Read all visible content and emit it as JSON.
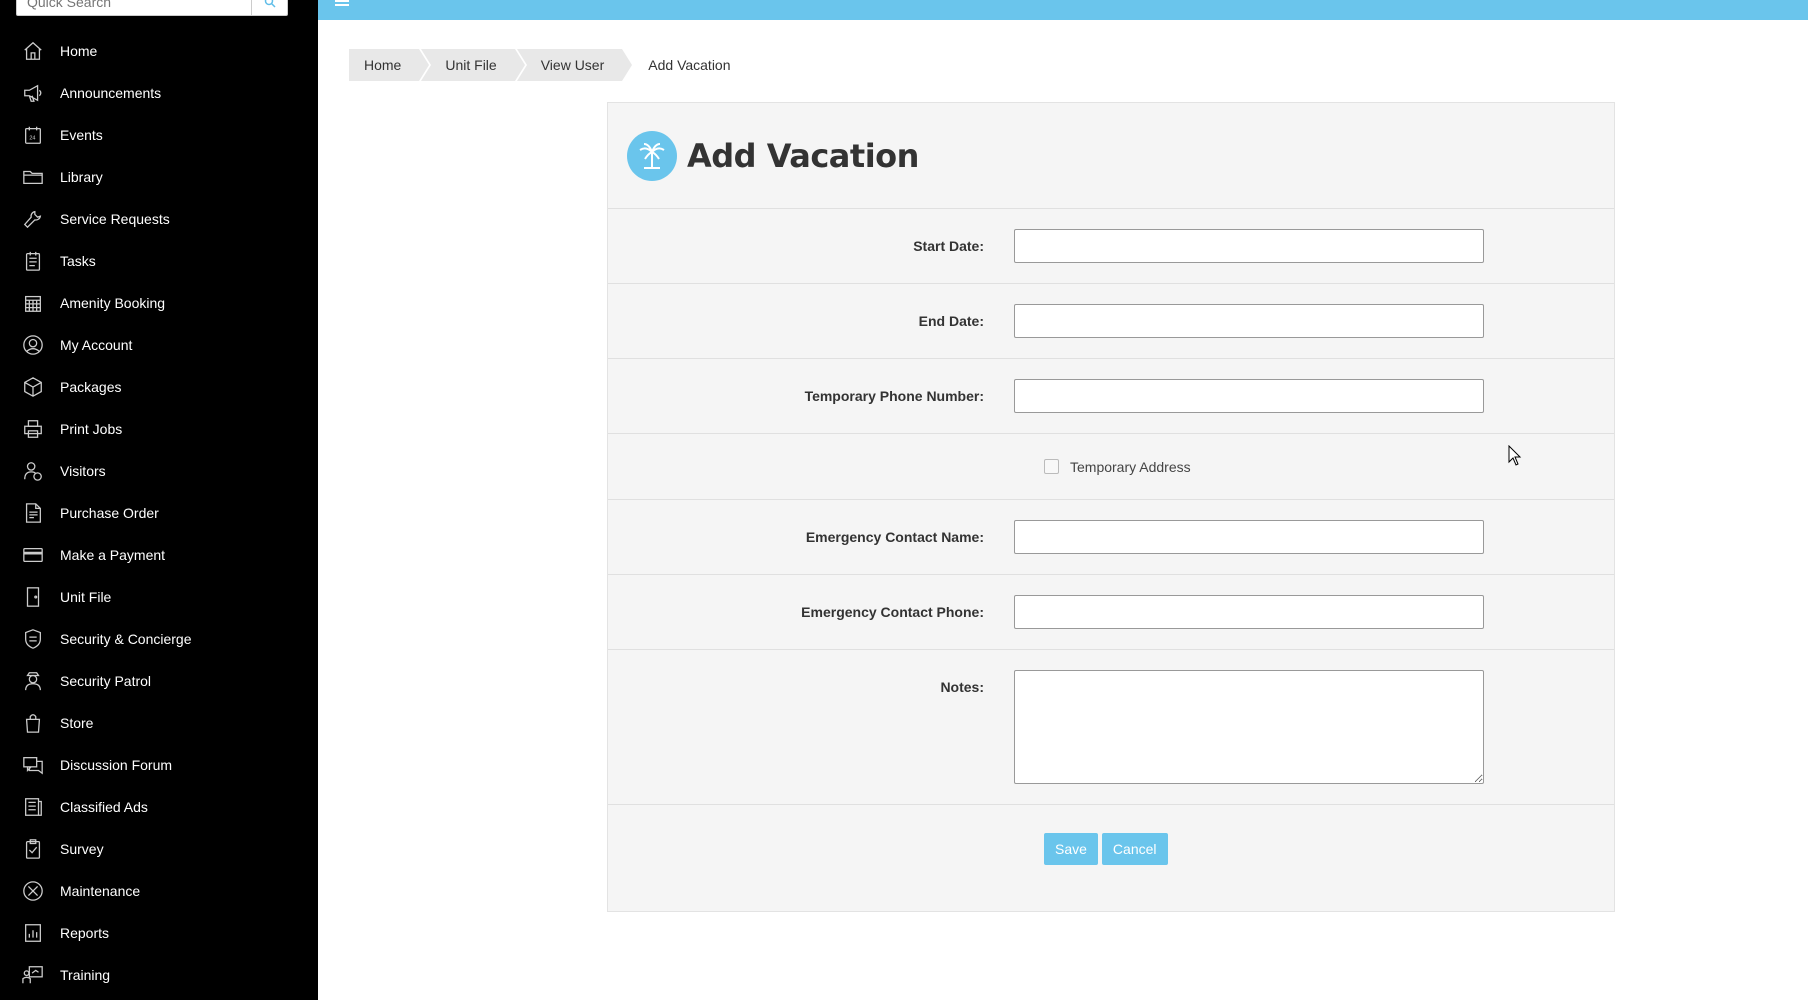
{
  "search": {
    "placeholder": "Quick Search"
  },
  "sidebar": {
    "items": [
      {
        "label": "Home",
        "icon": "home-icon"
      },
      {
        "label": "Announcements",
        "icon": "megaphone-icon"
      },
      {
        "label": "Events",
        "icon": "calendar-icon"
      },
      {
        "label": "Library",
        "icon": "folder-icon"
      },
      {
        "label": "Service Requests",
        "icon": "wrench-icon"
      },
      {
        "label": "Tasks",
        "icon": "checklist-icon"
      },
      {
        "label": "Amenity Booking",
        "icon": "calendar-grid-icon"
      },
      {
        "label": "My Account",
        "icon": "user-circle-icon"
      },
      {
        "label": "Packages",
        "icon": "box-icon"
      },
      {
        "label": "Print Jobs",
        "icon": "printer-icon"
      },
      {
        "label": "Visitors",
        "icon": "visitor-icon"
      },
      {
        "label": "Purchase Order",
        "icon": "document-icon"
      },
      {
        "label": "Make a Payment",
        "icon": "credit-card-icon"
      },
      {
        "label": "Unit File",
        "icon": "door-icon"
      },
      {
        "label": "Security & Concierge",
        "icon": "shield-icon"
      },
      {
        "label": "Security Patrol",
        "icon": "guard-icon"
      },
      {
        "label": "Store",
        "icon": "shopping-bag-icon"
      },
      {
        "label": "Discussion Forum",
        "icon": "chat-icon"
      },
      {
        "label": "Classified Ads",
        "icon": "newspaper-icon"
      },
      {
        "label": "Survey",
        "icon": "clipboard-icon"
      },
      {
        "label": "Maintenance",
        "icon": "tools-icon"
      },
      {
        "label": "Reports",
        "icon": "report-icon"
      },
      {
        "label": "Training",
        "icon": "training-icon"
      }
    ]
  },
  "breadcrumb": [
    "Home",
    "Unit File",
    "View User",
    "Add Vacation"
  ],
  "page": {
    "title": "Add Vacation",
    "icon": "palm-tree-icon"
  },
  "form": {
    "start_date": {
      "label": "Start Date:",
      "value": ""
    },
    "end_date": {
      "label": "End Date:",
      "value": ""
    },
    "temp_phone": {
      "label": "Temporary Phone Number:",
      "value": ""
    },
    "temp_address": {
      "label": "Temporary Address",
      "checked": false
    },
    "emergency_name": {
      "label": "Emergency Contact Name:",
      "value": ""
    },
    "emergency_phone": {
      "label": "Emergency Contact Phone:",
      "value": ""
    },
    "notes": {
      "label": "Notes:",
      "value": ""
    },
    "save_label": "Save",
    "cancel_label": "Cancel"
  },
  "colors": {
    "accent": "#6ac5ec",
    "sidebar_bg": "#000000"
  }
}
